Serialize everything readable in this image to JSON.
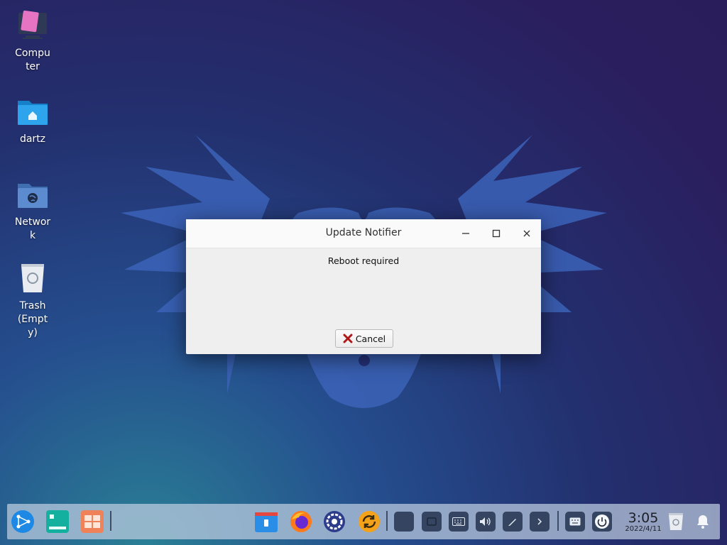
{
  "desktop": {
    "icons": [
      {
        "label": "Computer",
        "icon": "computer-icon"
      },
      {
        "label": "dartz",
        "icon": "home-folder-icon"
      },
      {
        "label": "Network",
        "icon": "network-folder-icon"
      },
      {
        "label": "Trash (Empty)",
        "icon": "trash-icon"
      }
    ]
  },
  "dialog": {
    "title": "Update Notifier",
    "message": "Reboot required",
    "cancel_label": "Cancel",
    "buttons": [
      "minimize-icon",
      "maximize-icon",
      "close-icon"
    ]
  },
  "taskbar": {
    "launcher_icons": [
      "start-menu-icon",
      "terminal-icon",
      "app-manager-icon"
    ],
    "pinned_apps": [
      "file-manager-icon",
      "firefox-icon",
      "settings-icon",
      "update-manager-icon"
    ],
    "tray_icons": [
      "tray-app-icon",
      "tray-window-icon",
      "keyboard-icon",
      "volume-icon",
      "pen-icon",
      "chevron-right-icon",
      "onscreen-keyboard-icon",
      "power-icon"
    ],
    "clock": {
      "time": "3:05",
      "date": "2022/4/11"
    },
    "end_icons": [
      "trash-icon",
      "notification-bell-icon"
    ]
  },
  "colors": {
    "accent": "#1e88e5",
    "dialog_bg": "#efefef",
    "taskbar_bg": "#bccce0"
  }
}
